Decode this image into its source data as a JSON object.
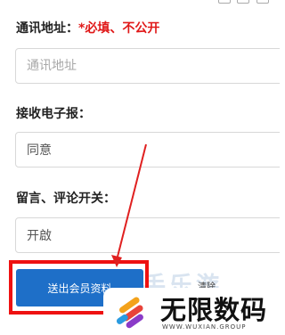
{
  "form": {
    "address": {
      "label": "通讯地址：",
      "required_note": "*必填、不公开",
      "placeholder": "通讯地址"
    },
    "newsletter": {
      "label": "接收电子报：",
      "value": "同意"
    },
    "comments": {
      "label": "留言、评论开关：",
      "value": "开啟"
    },
    "submit_label": "送出会员资料",
    "clear_label": "清除"
  },
  "overlay": {
    "background_watermark": "游手乐游",
    "logo_text": "无限数码",
    "logo_subtext": "WWW.WUXIAN.GROUP",
    "highlight_color": "#ee1111",
    "arrow_color": "#e02020"
  },
  "colors": {
    "submit_button": "#1e6fc8",
    "required_text": "#e01818"
  }
}
